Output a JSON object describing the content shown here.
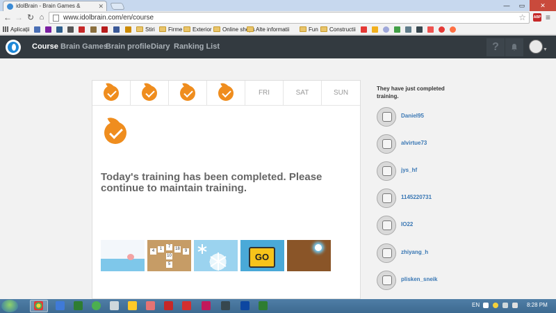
{
  "browser": {
    "tab_title": "idolBrain - Brain Games &",
    "url": "www.idolbrain.com/en/course",
    "bookmarks": [
      {
        "label": "Aplicații",
        "type": "apps"
      },
      {
        "label": "Stiri",
        "type": "folder"
      },
      {
        "label": "Firme",
        "type": "folder"
      },
      {
        "label": "Exterior",
        "type": "folder"
      },
      {
        "label": "Online shops",
        "type": "folder"
      },
      {
        "label": "Alte informatii",
        "type": "folder"
      },
      {
        "label": "Fun",
        "type": "folder"
      },
      {
        "label": "Constructii",
        "type": "folder"
      }
    ],
    "extension_badge": "ABP"
  },
  "nav": {
    "items": [
      "Course",
      "Brain Games",
      "Brain profile",
      "Diary",
      "Ranking List"
    ],
    "active": "Course",
    "help_icon_label": "?"
  },
  "week": {
    "days": [
      {
        "label": "",
        "completed": true
      },
      {
        "label": "",
        "completed": true
      },
      {
        "label": "",
        "completed": true
      },
      {
        "label": "",
        "completed": true
      },
      {
        "label": "FRI",
        "completed": false
      },
      {
        "label": "SAT",
        "completed": false
      },
      {
        "label": "SUN",
        "completed": false
      }
    ]
  },
  "main": {
    "message": "Today's training has been completed. Please continue to maintain training.",
    "game_numbers": [
      "4",
      "1",
      "7",
      "18",
      "10",
      "9",
      "5"
    ],
    "go_sign": "GO"
  },
  "sidebar": {
    "title": "They have just completed training.",
    "users": [
      "Daniel95",
      "alvirtue73",
      "jys_hf",
      "1145220731",
      "IO22",
      "zhiyang_h",
      "plisken_sneik"
    ]
  },
  "taskbar": {
    "language": "EN",
    "clock": "8:28 PM"
  }
}
